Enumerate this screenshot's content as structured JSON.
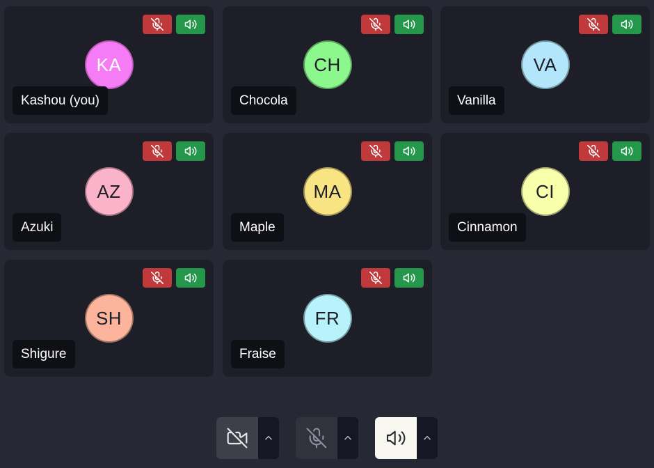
{
  "participants": [
    {
      "name": "Kashou (you)",
      "initials": "KA",
      "avatar_color": "#f57cf5",
      "initials_color": "#ffffff",
      "mic_muted": true,
      "speaker_on": true
    },
    {
      "name": "Chocola",
      "initials": "CH",
      "avatar_color": "#8cf78c",
      "initials_color": "#1d1e27",
      "mic_muted": true,
      "speaker_on": true
    },
    {
      "name": "Vanilla",
      "initials": "VA",
      "avatar_color": "#b3e6fb",
      "initials_color": "#1d1e27",
      "mic_muted": true,
      "speaker_on": true
    },
    {
      "name": "Azuki",
      "initials": "AZ",
      "avatar_color": "#fbb3c9",
      "initials_color": "#1d1e27",
      "mic_muted": true,
      "speaker_on": true
    },
    {
      "name": "Maple",
      "initials": "MA",
      "avatar_color": "#f8e483",
      "initials_color": "#1d1e27",
      "mic_muted": true,
      "speaker_on": true
    },
    {
      "name": "Cinnamon",
      "initials": "CI",
      "avatar_color": "#f8ffab",
      "initials_color": "#1d1e27",
      "mic_muted": true,
      "speaker_on": true
    },
    {
      "name": "Shigure",
      "initials": "SH",
      "avatar_color": "#fcb49c",
      "initials_color": "#1d1e27",
      "mic_muted": true,
      "speaker_on": true
    },
    {
      "name": "Fraise",
      "initials": "FR",
      "avatar_color": "#b8f3fb",
      "initials_color": "#1d1e27",
      "mic_muted": true,
      "speaker_on": true
    }
  ],
  "controls": {
    "camera": {
      "icon": "camera-off-icon",
      "state": "off"
    },
    "microphone": {
      "icon": "mic-off-icon",
      "state": "muted"
    },
    "speaker": {
      "icon": "speaker-icon",
      "state": "on"
    }
  },
  "colors": {
    "background": "#262834",
    "tile": "#1d1e27",
    "muted_badge": "#c0393b",
    "speaker_badge": "#24974a",
    "name_label": "#0f1016"
  }
}
